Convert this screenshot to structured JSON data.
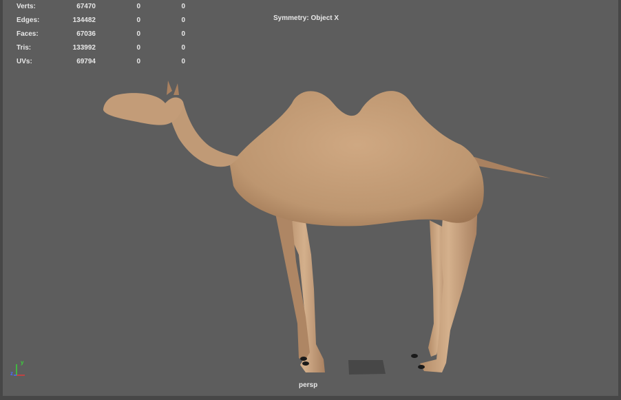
{
  "stats": [
    {
      "label": "Verts:",
      "values": [
        "67470",
        "0",
        "0"
      ]
    },
    {
      "label": "Edges:",
      "values": [
        "134482",
        "0",
        "0"
      ]
    },
    {
      "label": "Faces:",
      "values": [
        "67036",
        "0",
        "0"
      ]
    },
    {
      "label": "Tris:",
      "values": [
        "133992",
        "0",
        "0"
      ]
    },
    {
      "label": "UVs:",
      "values": [
        "69794",
        "0",
        "0"
      ]
    }
  ],
  "symmetry": "Symmetry: Object X",
  "camera": "persp",
  "axis": {
    "y": "y",
    "z": "z"
  },
  "colors": {
    "viewport_bg": "#5d5d5d",
    "hud_text": "#e8e8e8",
    "model_main": "#c29a74",
    "axis_x": "#e03a3a",
    "axis_y": "#3ad43a",
    "axis_z": "#4a6cff"
  }
}
